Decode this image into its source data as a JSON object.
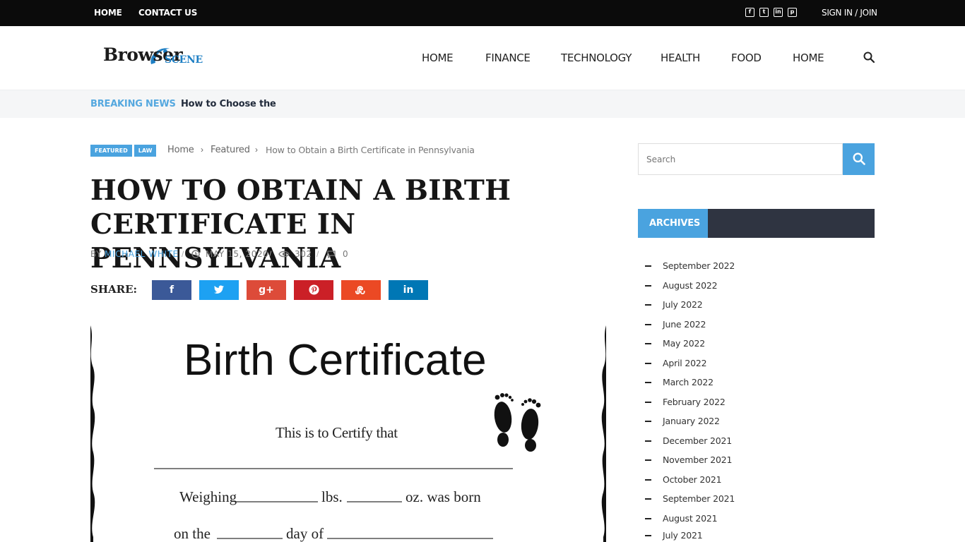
{
  "topbar": {
    "links": [
      "HOME",
      "CONTACT US"
    ],
    "social": [
      "facebook-icon",
      "twitter-icon",
      "linkedin-icon",
      "pinterest-icon"
    ],
    "signin": "SIGN IN / JOIN"
  },
  "header": {
    "logo_main": "Browser",
    "logo_sub": "SCENE",
    "nav": [
      "HOME",
      "FINANCE",
      "TECHNOLOGY",
      "HEALTH",
      "FOOD",
      "HOME"
    ],
    "search_icon": "search-icon"
  },
  "breaking": {
    "label": "BREAKING NEWS",
    "ticker": "How to Choose the Best"
  },
  "article": {
    "tags": [
      "FEATURED",
      "LAW"
    ],
    "breadcrumb": {
      "home": "Home",
      "section": "Featured",
      "current": "How to Obtain a Birth Certificate in Pennsylvania",
      "separator": "›"
    },
    "title_line1": "HOW TO OBTAIN A BIRTH",
    "title_line2": "CERTIFICATE IN PENNSYLVANIA",
    "meta": {
      "by": "BY",
      "author": "MICHAEL WHITE",
      "date": "MAY 15, 2020",
      "views": "302",
      "comments": "0",
      "separator": "/"
    },
    "share_label": "SHARE:",
    "share_buttons": [
      {
        "icon": "facebook-icon",
        "glyph": "f",
        "color": "#3b5998"
      },
      {
        "icon": "twitter-icon",
        "glyph": "🐦",
        "color": "#1da1f2"
      },
      {
        "icon": "google-plus-icon",
        "glyph": "g+",
        "color": "#dd4b39"
      },
      {
        "icon": "pinterest-icon",
        "glyph": "P",
        "color": "#cb2027"
      },
      {
        "icon": "stumbleupon-icon",
        "glyph": "su",
        "color": "#eb4924"
      },
      {
        "icon": "linkedin-icon",
        "glyph": "in",
        "color": "#0077b5"
      }
    ],
    "image": {
      "heading": "Birth Certificate",
      "line1": "This is to Certify that",
      "line2_a": "Weighing",
      "line2_b": "lbs.",
      "line2_c": "oz. was born",
      "line3_a": "on the",
      "line3_b": "day of"
    }
  },
  "sidebar": {
    "search_placeholder": "Search",
    "archives_title": "ARCHIVES",
    "archives": [
      "September 2022",
      "August 2022",
      "July 2022",
      "June 2022",
      "May 2022",
      "April 2022",
      "March 2022",
      "February 2022",
      "January 2022",
      "December 2021",
      "November 2021",
      "October 2021",
      "September 2021",
      "August 2021",
      "July 2021"
    ]
  },
  "colors": {
    "accent": "#4aa3df",
    "dark": "#2f3441",
    "topbar": "#0b0b0b"
  }
}
